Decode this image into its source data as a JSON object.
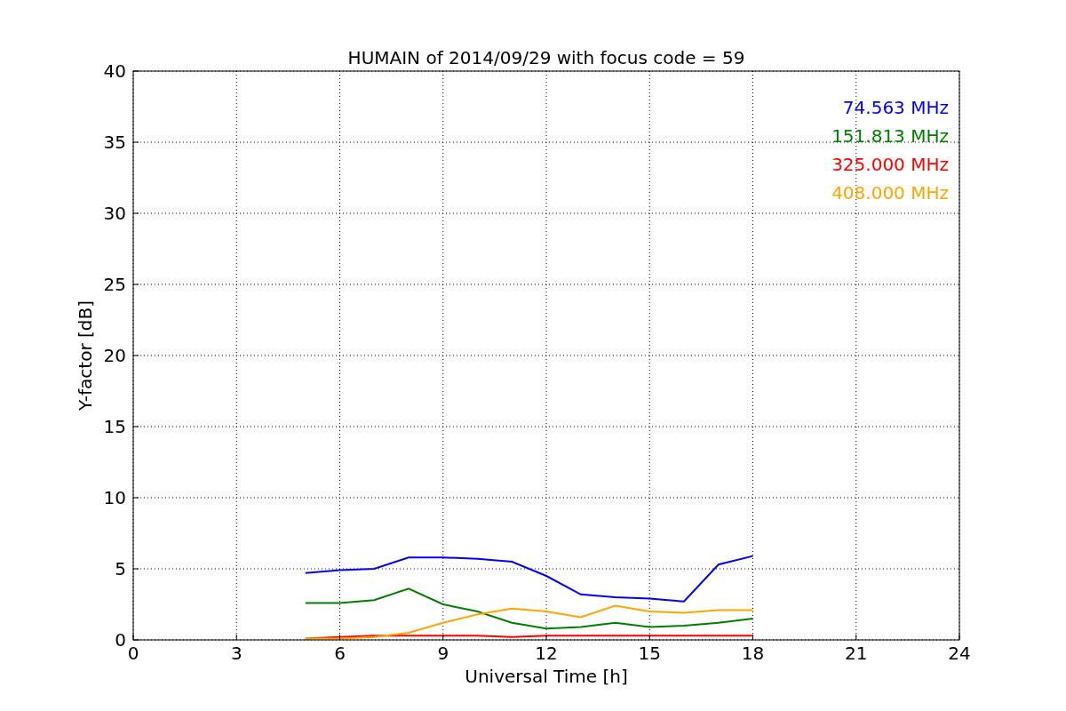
{
  "chart_data": {
    "type": "line",
    "title": "HUMAIN of 2014/09/29 with focus code = 59",
    "xlabel": "Universal Time [h]",
    "ylabel": "Y-factor [dB]",
    "x": [
      5,
      6,
      7,
      8,
      9,
      10,
      11,
      12,
      13,
      14,
      15,
      16,
      17,
      18
    ],
    "series": [
      {
        "name": "74.563 MHz",
        "color": "#0000ff",
        "values": [
          4.7,
          4.9,
          5.0,
          5.8,
          5.8,
          5.7,
          5.5,
          4.5,
          3.2,
          3.0,
          2.9,
          2.7,
          5.3,
          5.9
        ]
      },
      {
        "name": "151.813 MHz",
        "color": "#008000",
        "values": [
          2.6,
          2.6,
          2.8,
          3.6,
          2.5,
          2.0,
          1.2,
          0.8,
          0.9,
          1.2,
          0.9,
          1.0,
          1.2,
          1.5
        ]
      },
      {
        "name": "325.000 MHz",
        "color": "#ff0000",
        "values": [
          0.1,
          0.2,
          0.3,
          0.3,
          0.3,
          0.3,
          0.2,
          0.3,
          0.3,
          0.3,
          0.3,
          0.3,
          0.3,
          0.3
        ]
      },
      {
        "name": "408.000 MHz",
        "color": "#ffa500",
        "values": [
          0.1,
          0.1,
          0.2,
          0.5,
          1.2,
          1.8,
          2.2,
          2.0,
          1.6,
          2.4,
          2.0,
          1.9,
          2.1,
          2.1
        ]
      }
    ],
    "grid": true,
    "xlim": [
      0,
      24
    ],
    "ylim": [
      0,
      40
    ],
    "xticks": [
      0,
      3,
      6,
      9,
      12,
      15,
      18,
      21,
      24
    ],
    "yticks": [
      0,
      5,
      10,
      15,
      20,
      25,
      30,
      35,
      40
    ]
  }
}
